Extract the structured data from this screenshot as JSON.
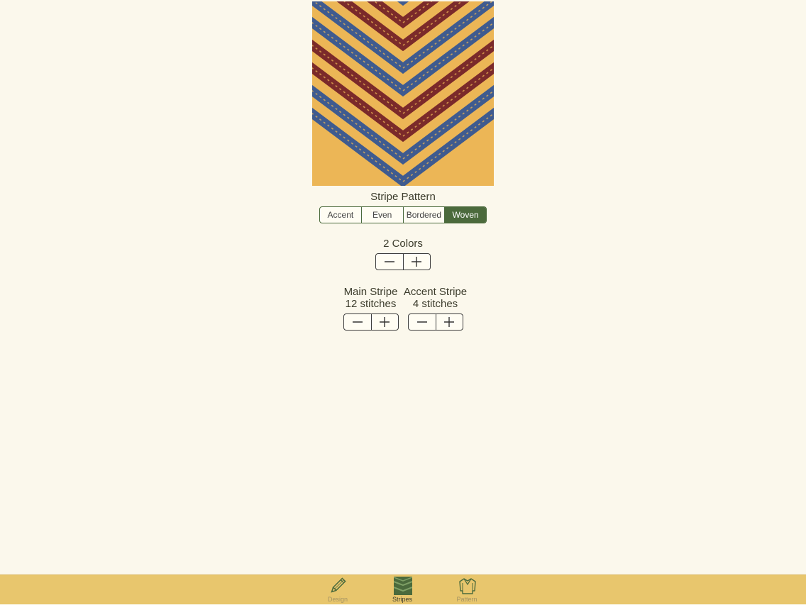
{
  "stripe_pattern": {
    "title": "Stripe Pattern",
    "options": [
      "Accent",
      "Even",
      "Bordered",
      "Woven"
    ],
    "selected": "Woven"
  },
  "colors": {
    "label": "2 Colors"
  },
  "main_stripe": {
    "title": "Main Stripe",
    "value": "12 stitches"
  },
  "accent_stripe": {
    "title": "Accent Stripe",
    "value": "4 stitches"
  },
  "tabbar": {
    "tabs": [
      {
        "label": "Design",
        "icon": "pencil-icon",
        "active": false
      },
      {
        "label": "Stripes",
        "icon": "stripes-icon",
        "active": true
      },
      {
        "label": "Pattern",
        "icon": "sweater-icon",
        "active": false
      }
    ]
  },
  "theme": {
    "background": "#fbf8ec",
    "accent_green": "#4b6a3c",
    "tab_bar": "#e8c66d",
    "yarn_gold": "#ecb656",
    "yarn_red": "#7b2a2a",
    "yarn_blue": "#3f5b8f"
  }
}
